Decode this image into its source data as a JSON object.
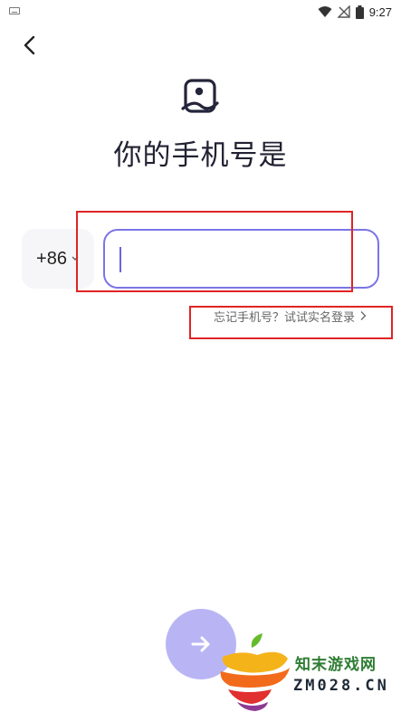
{
  "status_bar": {
    "time": "9:27",
    "icons": [
      "keyboard-icon",
      "wifi-icon",
      "no-signal-icon",
      "battery-icon"
    ]
  },
  "header": {
    "back_icon": "chevron-left-icon",
    "title": "你的手机号是"
  },
  "form": {
    "country_code": "+86",
    "phone_value": "",
    "phone_placeholder": ""
  },
  "forgot_link": {
    "label": "忘记手机号？试试实名登录"
  },
  "next_button": {
    "icon": "arrow-right-icon"
  },
  "watermark": {
    "line1": "知末游戏网",
    "line2": "ZM028.CN"
  },
  "colors": {
    "accent": "#7b74e6",
    "next_button_bg": "#b9b5f4",
    "highlight": "#e02424"
  }
}
